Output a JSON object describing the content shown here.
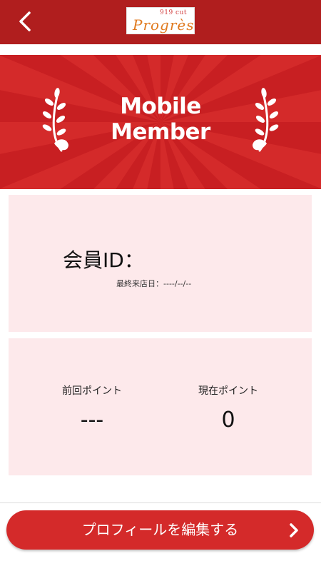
{
  "header": {
    "back_icon": "chevron-left-icon",
    "logo": {
      "top_text": "919 cut",
      "main_text": "Progrès"
    }
  },
  "banner": {
    "title_line1": "Mobile",
    "title_line2": "Member",
    "icons": [
      "laurel-left-icon",
      "laurel-right-icon"
    ]
  },
  "member_card": {
    "id_label": "会員ID：",
    "id_value": "",
    "last_visit_label": "最終来店日：",
    "last_visit_value": "----/--/--"
  },
  "points_card": {
    "previous_label": "前回ポイント",
    "previous_value": "---",
    "current_label": "現在ポイント",
    "current_value": "0"
  },
  "edit_button": {
    "label": "プロフィールを編集する",
    "icon": "chevron-right-icon"
  },
  "colors": {
    "header_bg": "#b01e1e",
    "accent_red": "#d42a2a",
    "card_bg": "#fde9eb",
    "logo_orange": "#e07a1f"
  }
}
